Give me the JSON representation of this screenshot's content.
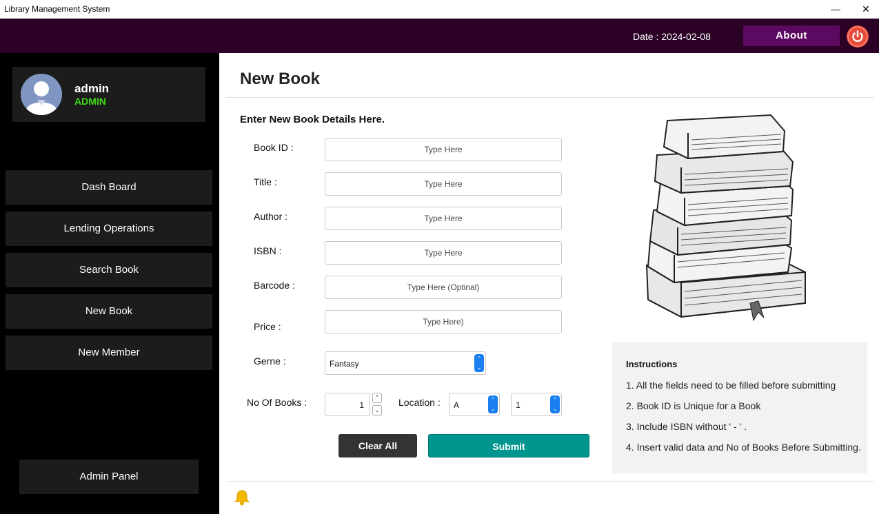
{
  "window": {
    "title": "Library Management System",
    "minimize": "—",
    "close": "✕"
  },
  "topbar": {
    "date": "Date : 2024-02-08",
    "about": "About",
    "power_icon": "power-icon"
  },
  "user": {
    "name": "admin",
    "role": "ADMIN"
  },
  "nav": {
    "items": [
      {
        "label": "Dash Board"
      },
      {
        "label": "Lending Operations"
      },
      {
        "label": "Search Book"
      },
      {
        "label": "New Book"
      },
      {
        "label": "New Member"
      }
    ],
    "admin_panel": "Admin Panel"
  },
  "page": {
    "title": "New Book",
    "form_heading": "Enter New Book Details Here."
  },
  "form": {
    "book_id": {
      "label": "Book ID :",
      "placeholder": "Type Here"
    },
    "title": {
      "label": "Title  :",
      "placeholder": "Type Here"
    },
    "author": {
      "label": "Author :",
      "placeholder": "Type Here"
    },
    "isbn": {
      "label": "ISBN :",
      "placeholder": "Type Here"
    },
    "barcode": {
      "label": "Barcode :",
      "placeholder": "Type Here (Optinal)"
    },
    "price": {
      "label": "Price :",
      "placeholder": "Type Here)"
    },
    "genre": {
      "label": "Gerne :",
      "value": "Fantasy"
    },
    "no_of_books": {
      "label": "No Of Books :",
      "value": "1"
    },
    "location": {
      "label": "Location :",
      "row_value": "A",
      "shelf_value": "1"
    }
  },
  "buttons": {
    "clear": "Clear All",
    "submit": "Submit"
  },
  "instructions": {
    "heading": "Instructions",
    "items": [
      "1. All the fields need to be filled before submitting",
      "2. Book ID is Unique for a Book",
      "3. Include ISBN without ' - ' .",
      "4. Insert valid data and No of Books Before Submitting."
    ]
  },
  "colors": {
    "topbar": "#2b0226",
    "about_button": "#5c0a61",
    "role": "#3ddc16",
    "submit": "#00968f",
    "clear": "#333333"
  }
}
